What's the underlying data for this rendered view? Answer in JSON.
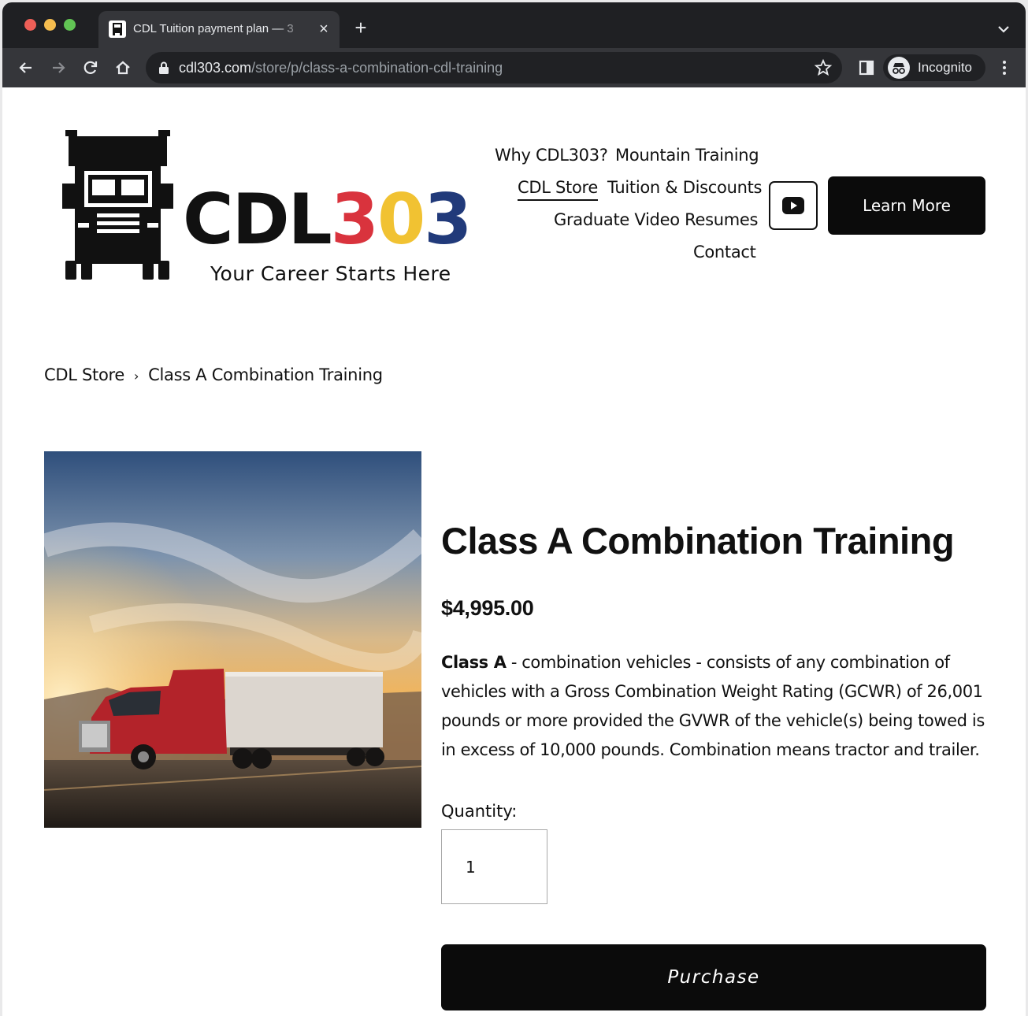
{
  "browser": {
    "tab_title": "CDL Tuition payment plan — 3",
    "tab_close": "×",
    "new_tab": "+",
    "url_host": "cdl303.com",
    "url_path": "/store/p/class-a-combination-cdl-training",
    "profile_label": "Incognito",
    "icons": [
      "back-icon",
      "forward-icon",
      "reload-icon",
      "home-icon",
      "lock-icon",
      "star-icon",
      "side-panel-icon",
      "incognito-icon",
      "menu-icon",
      "tab-search-icon"
    ]
  },
  "logo": {
    "brand_prefix": "CDL",
    "brand_digit_1": "3",
    "brand_digit_2": "0",
    "brand_digit_3": "3",
    "tagline": "Your Career Starts Here",
    "colors": {
      "red": "#d9333d",
      "yellow": "#f1c232",
      "blue": "#213a7a"
    }
  },
  "nav": {
    "why": "Why CDL303?",
    "mountain": "Mountain Training",
    "store": "CDL Store",
    "tuition": "Tuition & Discounts",
    "resumes": "Graduate Video Resumes",
    "contact": "Contact",
    "learn_more": "Learn More"
  },
  "breadcrumb": {
    "parent": "CDL Store",
    "separator": "›",
    "current": "Class A Combination Training"
  },
  "product": {
    "title": "Class A Combination Training",
    "price": "$4,995.00",
    "description_bold": "Class A",
    "description_rest": " - combination vehicles - consists of any combination of vehicles with a Gross Combination Weight Rating (GCWR) of 26,001 pounds or more provided the GVWR of the vehicle(s) being towed is in excess of 10,000 pounds. Combination means tractor and trailer.",
    "quantity_label": "Quantity:",
    "quantity_value": "1",
    "purchase_label": "Purchase"
  }
}
